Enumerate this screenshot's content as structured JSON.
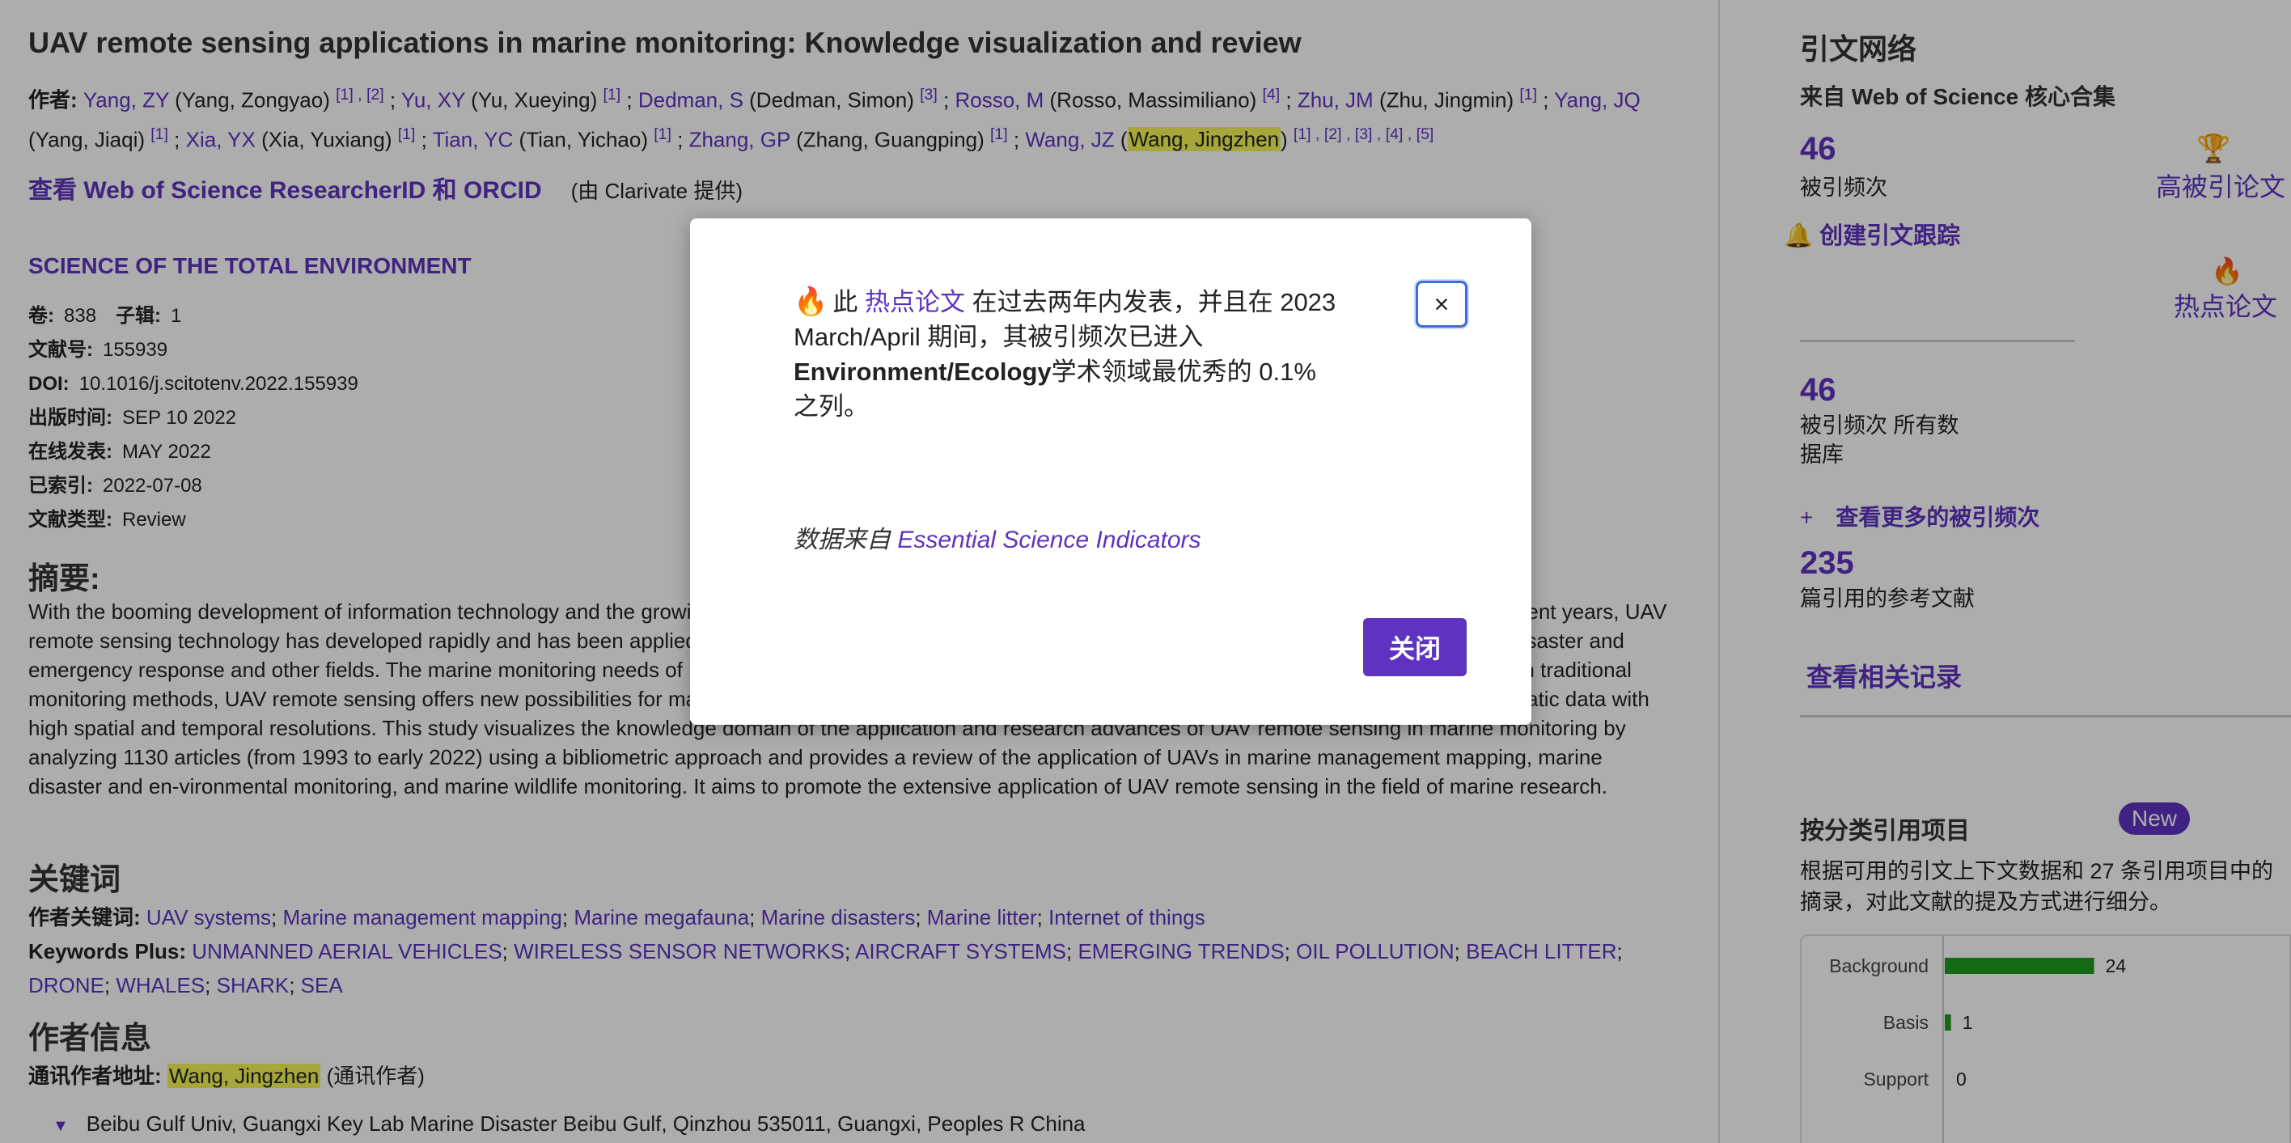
{
  "article": {
    "title": "UAV remote sensing applications in marine monitoring: Knowledge visualization and review",
    "authors_label": "作者:",
    "authors": [
      {
        "short": "Yang, ZY",
        "full": "(Yang, Zongyao)",
        "refs": "[1] , [2]",
        "highlight": false
      },
      {
        "short": "Yu, XY",
        "full": "(Yu, Xueying)",
        "refs": "[1]",
        "highlight": false
      },
      {
        "short": "Dedman, S",
        "full": "(Dedman, Simon)",
        "refs": "[3]",
        "highlight": false
      },
      {
        "short": "Rosso, M",
        "full": "(Rosso, Massimiliano)",
        "refs": "[4]",
        "highlight": false
      },
      {
        "short": "Zhu, JM",
        "full": "(Zhu, Jingmin)",
        "refs": "[1]",
        "highlight": false
      },
      {
        "short": "Yang, JQ",
        "full": "(Yang, Jiaqi)",
        "refs": "[1]",
        "highlight": false
      },
      {
        "short": "Xia, YX",
        "full": "(Xia, Yuxiang)",
        "refs": "[1]",
        "highlight": false
      },
      {
        "short": "Tian, YC",
        "full": "(Tian, Yichao)",
        "refs": "[1]",
        "highlight": false
      },
      {
        "short": "Zhang, GP",
        "full": "(Zhang, Guangping)",
        "refs": "[1]",
        "highlight": false
      },
      {
        "short": "Wang, JZ",
        "full": "Wang, Jingzhen",
        "refs": "[1] , [2] , [3] , [4] , [5]",
        "highlight": true
      }
    ],
    "researcher_link": "查看 Web of Science ResearcherID 和 ORCID",
    "provided_by": "(由 Clarivate 提供)",
    "journal": "SCIENCE OF THE TOTAL ENVIRONMENT",
    "volume_label": "卷:",
    "volume": "838",
    "issue_label": "子辑:",
    "issue": "1",
    "article_no_label": "文献号:",
    "article_no": "155939",
    "doi_label": "DOI:",
    "doi": "10.1016/j.scitotenv.2022.155939",
    "pub_date_label": "出版时间:",
    "pub_date": "SEP 10 2022",
    "online_label": "在线发表:",
    "online": "MAY 2022",
    "indexed_label": "已索引:",
    "indexed": "2022-07-08",
    "doc_type_label": "文献类型:",
    "doc_type": "Review",
    "abstract_heading": "摘要:",
    "abstract": "With the booming development of information technology and the growing demand for remote sensing data, UAV remote sensing technology has emerged. In recent years, UAV remote sensing technology has developed rapidly and has been applied in precision agriculture, forestry monitoring, surveying and mapping management, and disaster and emergency response and other fields. The marine monitoring needs of marine ecosystems are raising the need for effective and timely monitoring. Compared with traditional monitoring methods, UAV remote sensing offers new possibilities for marine monitoring thanks to its flexibility, efficiency and low cost, while still producing systematic data with high spatial and temporal resolutions. This study visualizes the knowledge domain of the application and research advances of UAV remote sensing in marine monitoring by analyzing 1130 articles (from 1993 to early 2022) using a bibliometric approach and provides a review of the application of UAVs in marine management mapping, marine disaster and en-vironmental monitoring, and marine wildlife monitoring. It aims to promote the extensive application of UAV remote sensing in the field of marine research.",
    "keywords_heading": "关键词",
    "author_kw_label": "作者关键词:",
    "author_keywords": [
      "UAV systems",
      "Marine management mapping",
      "Marine megafauna",
      "Marine disasters",
      "Marine litter",
      "Internet of things"
    ],
    "kwplus_label": "Keywords Plus:",
    "keywords_plus": [
      "UNMANNED AERIAL VEHICLES",
      "WIRELESS SENSOR NETWORKS",
      "AIRCRAFT SYSTEMS",
      "EMERGING TRENDS",
      "OIL POLLUTION",
      "BEACH LITTER",
      "DRONE",
      "WHALES",
      "SHARK",
      "SEA"
    ],
    "author_info_heading": "作者信息",
    "corr_label": "通讯作者地址:",
    "corr_name": "Wang, Jingzhen",
    "corr_suffix": "(通讯作者)",
    "address": "Beibu Gulf Univ, Guangxi Key Lab Marine Disaster Beibu Gulf, Qinzhou 535011, Guangxi, Peoples R China"
  },
  "sidebar": {
    "title": "引文网络",
    "source": "来自 Web of Science 核心合集",
    "times_cited": "46",
    "times_cited_label": "被引频次",
    "create_alert": "创建引文跟踪",
    "highly_cited": "高被引论文",
    "hot_paper": "热点论文",
    "all_db_count": "46",
    "all_db_label": "被引频次 所有数据库",
    "see_more": "查看更多的被引频次",
    "plus": "+",
    "refs_count": "235",
    "refs_label": "篇引用的参考文献",
    "related": "查看相关记录",
    "category_heading": "按分类引用项目",
    "new_badge": "New",
    "category_desc": "根据可用的引文上下文数据和 27 条引用项目中的摘录，对此文献的提及方式进行细分。"
  },
  "chart_data": {
    "type": "bar",
    "orientation": "horizontal",
    "categories": [
      "Background",
      "Basis",
      "Support"
    ],
    "values": [
      24,
      1,
      0
    ],
    "color": "#1e9c1e",
    "xlim": [
      0,
      26
    ]
  },
  "modal": {
    "prefix": "此",
    "hot_link": "热点论文",
    "body": "在过去两年内发表，并且在 2023 March/April 期间，其被引频次已进入",
    "field": "Environment/Ecology",
    "suffix": "学术领域最优秀的 0.1% 之列。",
    "source_prefix": "数据来自",
    "source_link": "Essential Science Indicators",
    "close_x": "×",
    "close_button": "关闭"
  }
}
